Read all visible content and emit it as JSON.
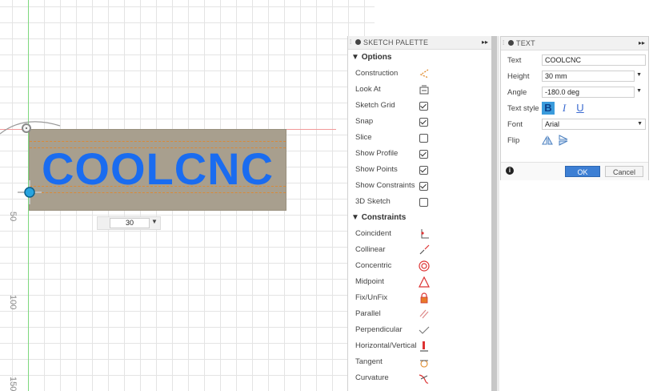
{
  "canvas": {
    "ruler_labels": [
      "50",
      "100",
      "150"
    ],
    "sketch_text": "COOLCNC",
    "dimension_value": "30",
    "colors": {
      "text_fill": "#1a6cf0",
      "text_box": "#a89f8e",
      "vertical_axis": "#7dd87d",
      "horizontal_axis": "#f29a9a"
    }
  },
  "palette": {
    "title": "SKETCH PALETTE",
    "options_header": "Options",
    "options": [
      {
        "label": "Construction",
        "icon": "construction-icon"
      },
      {
        "label": "Look At",
        "icon": "look-at-icon"
      },
      {
        "label": "Sketch Grid",
        "checked": true
      },
      {
        "label": "Snap",
        "checked": true
      },
      {
        "label": "Slice",
        "checked": false
      },
      {
        "label": "Show Profile",
        "checked": true
      },
      {
        "label": "Show Points",
        "checked": true
      },
      {
        "label": "Show Constraints",
        "checked": true
      },
      {
        "label": "3D Sketch",
        "checked": false
      }
    ],
    "constraints_header": "Constraints",
    "constraints": [
      {
        "label": "Coincident",
        "icon": "coincident-icon"
      },
      {
        "label": "Collinear",
        "icon": "collinear-icon"
      },
      {
        "label": "Concentric",
        "icon": "concentric-icon"
      },
      {
        "label": "Midpoint",
        "icon": "midpoint-icon"
      },
      {
        "label": "Fix/UnFix",
        "icon": "fix-unfix-icon"
      },
      {
        "label": "Parallel",
        "icon": "parallel-icon"
      },
      {
        "label": "Perpendicular",
        "icon": "perpendicular-icon"
      },
      {
        "label": "Horizontal/Vertical",
        "icon": "horizontal-vertical-icon"
      },
      {
        "label": "Tangent",
        "icon": "tangent-icon"
      },
      {
        "label": "Curvature",
        "icon": "curvature-icon"
      }
    ]
  },
  "dialog": {
    "title": "TEXT",
    "text_label": "Text",
    "text_value": "COOLCNC",
    "height_label": "Height",
    "height_value": "30 mm",
    "angle_label": "Angle",
    "angle_value": "-180.0 deg",
    "style_label": "Text style",
    "bold": "B",
    "italic": "I",
    "underline": "U",
    "font_label": "Font",
    "font_value": "Arial",
    "flip_label": "Flip",
    "ok_label": "OK",
    "cancel_label": "Cancel",
    "accent": "#3d7fd4"
  }
}
